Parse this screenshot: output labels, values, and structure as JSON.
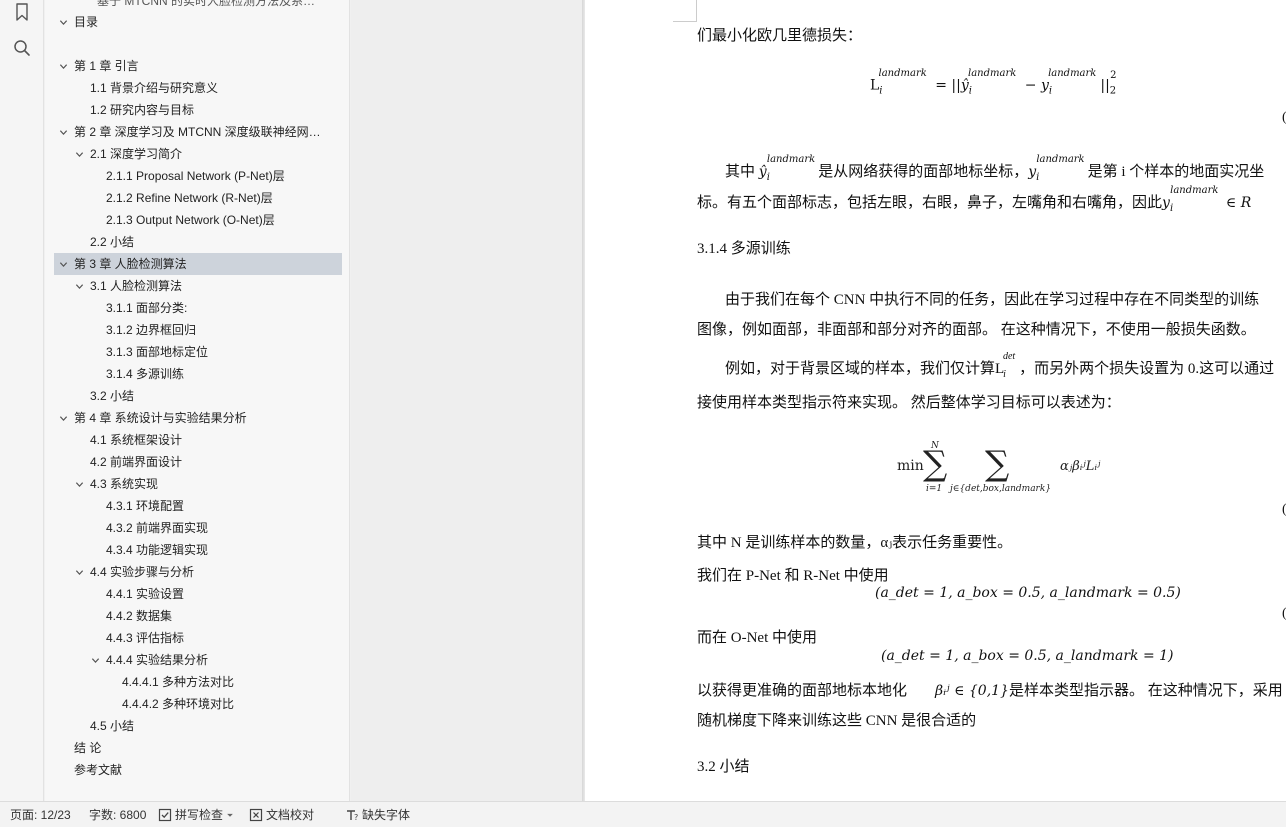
{
  "outline": {
    "clipped_top": "基于 MTCNN 的实时人脸检测方法及系…",
    "items": [
      {
        "label": "目录",
        "level": 0,
        "expand": true
      },
      {
        "label": "",
        "level": 0,
        "expand": false
      },
      {
        "label": "第 1 章  引言",
        "level": 0,
        "expand": true
      },
      {
        "label": "1.1 背景介绍与研究意义",
        "level": 1,
        "expand": false
      },
      {
        "label": "1.2 研究内容与目标",
        "level": 1,
        "expand": false
      },
      {
        "label": "第 2 章  深度学习及 MTCNN 深度级联神经网…",
        "level": 0,
        "expand": true
      },
      {
        "label": "2.1  深度学习简介",
        "level": 1,
        "expand": true
      },
      {
        "label": "2.1.1 Proposal Network (P-Net)层",
        "level": 2,
        "expand": false
      },
      {
        "label": "2.1.2 Refine Network (R-Net)层",
        "level": 2,
        "expand": false
      },
      {
        "label": "2.1.3 Output Network (O-Net)层",
        "level": 2,
        "expand": false
      },
      {
        "label": "2.2 小结",
        "level": 1,
        "expand": false
      },
      {
        "label": "第 3 章  人脸检测算法",
        "level": 0,
        "expand": true,
        "selected": true
      },
      {
        "label": "3.1  人脸检测算法",
        "level": 1,
        "expand": true
      },
      {
        "label": "3.1.1  面部分类:",
        "level": 2,
        "expand": false
      },
      {
        "label": "3.1.2  边界框回归",
        "level": 2,
        "expand": false
      },
      {
        "label": "3.1.3  面部地标定位",
        "level": 2,
        "expand": false
      },
      {
        "label": "3.1.4  多源训练",
        "level": 2,
        "expand": false
      },
      {
        "label": "3.2  小结",
        "level": 1,
        "expand": false
      },
      {
        "label": "第 4 章  系统设计与实验结果分析",
        "level": 0,
        "expand": true
      },
      {
        "label": "4.1 系统框架设计",
        "level": 1,
        "expand": false
      },
      {
        "label": "4.2 前端界面设计",
        "level": 1,
        "expand": false
      },
      {
        "label": "4.3 系统实现",
        "level": 1,
        "expand": true
      },
      {
        "label": "4.3.1  环境配置",
        "level": 2,
        "expand": false
      },
      {
        "label": "4.3.2  前端界面实现",
        "level": 2,
        "expand": false
      },
      {
        "label": "4.3.4 功能逻辑实现",
        "level": 2,
        "expand": false
      },
      {
        "label": "4.4 实验步骤与分析",
        "level": 1,
        "expand": true
      },
      {
        "label": "4.4.1  实验设置",
        "level": 2,
        "expand": false
      },
      {
        "label": "4.4.2  数据集",
        "level": 2,
        "expand": false
      },
      {
        "label": "4.4.3  评估指标",
        "level": 2,
        "expand": false
      },
      {
        "label": "4.4.4  实验结果分析",
        "level": 2,
        "expand": true
      },
      {
        "label": "4.4.4.1 多种方法对比",
        "level": 3,
        "expand": false
      },
      {
        "label": "4.4.4.2 多种环境对比",
        "level": 3,
        "expand": false
      },
      {
        "label": "4.5 小结",
        "level": 1,
        "expand": false
      },
      {
        "label": "结    论",
        "level": 0,
        "expand": false
      },
      {
        "label": "参考文献",
        "level": 0,
        "expand": false
      }
    ]
  },
  "doc": {
    "line1": "们最小化欧几里德损失：",
    "eq1": "Lᵢ^landmark = ||ŷᵢ^landmark − yᵢ^landmark||₂²",
    "eq1_lhs": "L",
    "eq1_sup": "landmark",
    "eq1_mid": " = ||",
    "eq1_yhat": "ŷ",
    "eq1_minus": " − ",
    "eq1_y": "y",
    "eq1_end": "||",
    "eq1_pow": "2",
    "para1_a": "其中 ",
    "para1_b": "是从网络获得的面部地标坐标，",
    "para1_c": "是第 i 个样本的地面实况坐",
    "para1_line2": "标。有五个面部标志，包括左眼，右眼，鼻子，左嘴角和右嘴角，因此",
    "para1_in": " ∈ R",
    "h314": "3.1.4  多源训练",
    "para2_line1": "由于我们在每个 CNN 中执行不同的任务，因此在学习过程中存在不同类型的训练",
    "para2_line2": "图像，例如面部，非面部和部分对齐的面部。 在这种情况下，不使用一般损失函数。",
    "para3_line1a": "例如，对于背景区域的样本，我们仅计算L",
    "para3_det": "det",
    "para3_line1b": "，而另外两个损失设置为 0.这可以通过",
    "para3_line2": "接使用样本类型指示符来实现。 然后整体学习目标可以表述为：",
    "eq2_min": "min",
    "eq2_N": "N",
    "eq2_lower1": "i=1",
    "eq2_lower2": "j∈{det,box,landmark}",
    "eq2_body": "αⱼβᵢʲLᵢʲ",
    "para4": "其中 N 是训练样本的数量，αⱼ表示任务重要性。",
    "para5": "我们在 P-Net 和 R-Net 中使用",
    "eq3": "(a_det = 1, a_box = 0.5, a_landmark = 0.5)",
    "para6": "而在 O-Net 中使用",
    "eq4": "(a_det = 1, a_box = 0.5, a_landmark = 1)",
    "para7_a": "以获得更准确的面部地标本地化",
    "para7_b": "βᵢʲ ∈ {0,1}",
    "para7_c": "是样本类型指示器。 在这种情况下，采用",
    "para7_line2": "随机梯度下降来训练这些 CNN 是很合适的",
    "h32": "3.2  小结",
    "eqno_char": "("
  },
  "status": {
    "page": "页面: 12/23",
    "words": "字数: 6800",
    "spell": "拼写检查",
    "proof": "文档校对",
    "font": "缺失字体"
  },
  "icons": {
    "rail": [
      "bookmark-icon",
      "search-icon"
    ],
    "status": [
      "check-box-icon",
      "dropdown-caret-icon",
      "proofread-icon",
      "missing-font-icon"
    ]
  }
}
